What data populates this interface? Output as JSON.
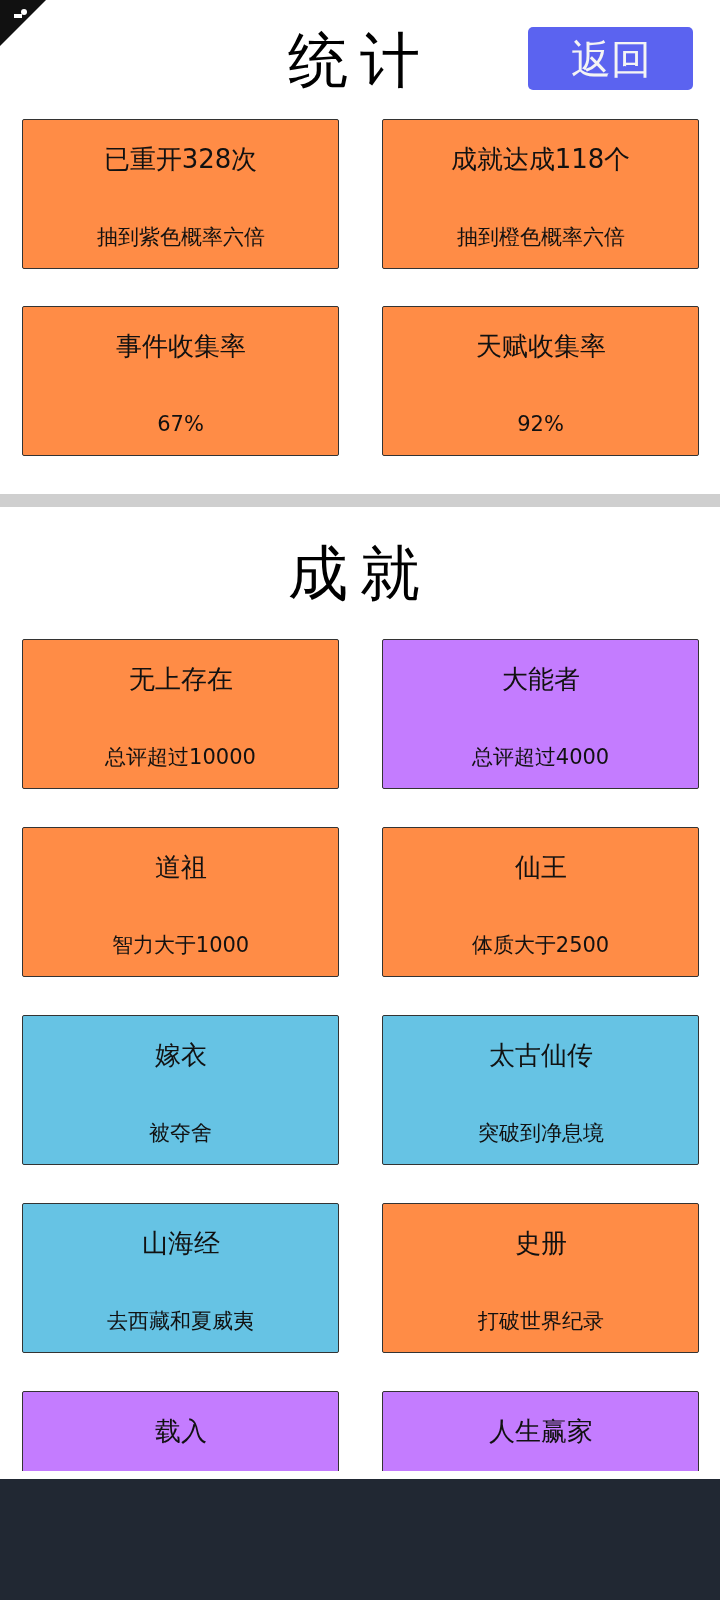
{
  "stats": {
    "title": "统计",
    "back_button": "返回",
    "cards": [
      {
        "title": "已重开328次",
        "value": "抽到紫色概率六倍"
      },
      {
        "title": "成就达成118个",
        "value": "抽到橙色概率六倍"
      },
      {
        "title": "事件收集率",
        "value": "67%"
      },
      {
        "title": "天赋收集率",
        "value": "92%"
      }
    ]
  },
  "achievements": {
    "title": "成就",
    "cards": [
      {
        "title": "无上存在",
        "desc": "总评超过10000",
        "color": "#ff8c46"
      },
      {
        "title": "大能者",
        "desc": "总评超过4000",
        "color": "#c47cff"
      },
      {
        "title": "道祖",
        "desc": "智力大于1000",
        "color": "#ff8c46"
      },
      {
        "title": "仙王",
        "desc": "体质大于2500",
        "color": "#ff8c46"
      },
      {
        "title": "嫁衣",
        "desc": "被夺舍",
        "color": "#66c3e4"
      },
      {
        "title": "太古仙传",
        "desc": "突破到净息境",
        "color": "#66c3e4"
      },
      {
        "title": "山海经",
        "desc": "去西藏和夏威夷",
        "color": "#66c3e4"
      },
      {
        "title": "史册",
        "desc": "打破世界纪录",
        "color": "#ff8c46"
      },
      {
        "title": "载入",
        "color": "#c47cff"
      },
      {
        "title": "人生赢家",
        "color": "#c47cff"
      }
    ]
  }
}
